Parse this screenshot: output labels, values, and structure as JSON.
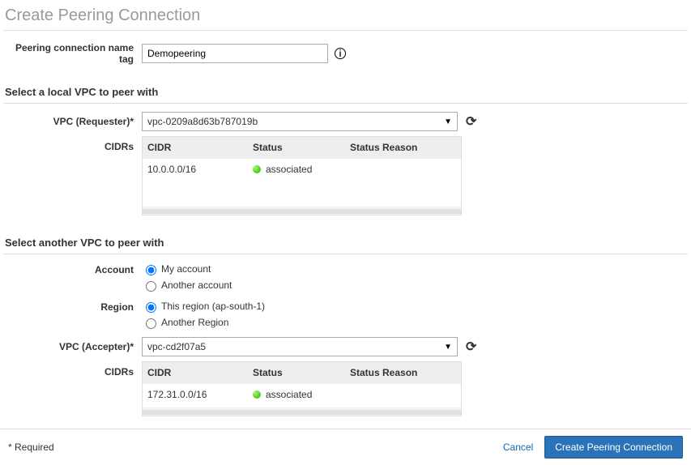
{
  "header": {
    "title": "Create Peering Connection"
  },
  "nameTag": {
    "label": "Peering connection name tag",
    "value": "Demopeering"
  },
  "sectionLocal": {
    "title": "Select a local VPC to peer with",
    "requesterLabel": "VPC (Requester)*",
    "requesterValue": "vpc-0209a8d63b787019b",
    "cidrsLabel": "CIDRs",
    "table": {
      "headers": {
        "cidr": "CIDR",
        "status": "Status",
        "reason": "Status Reason"
      },
      "rows": [
        {
          "cidr": "10.0.0.0/16",
          "status": "associated",
          "reason": ""
        }
      ]
    }
  },
  "sectionOther": {
    "title": "Select another VPC to peer with",
    "accountLabel": "Account",
    "accountOptions": {
      "mine": "My account",
      "another": "Another account"
    },
    "regionLabel": "Region",
    "regionOptions": {
      "this": "This region (ap-south-1)",
      "another": "Another Region"
    },
    "accepterLabel": "VPC (Accepter)*",
    "accepterValue": "vpc-cd2f07a5",
    "cidrsLabel": "CIDRs",
    "table": {
      "headers": {
        "cidr": "CIDR",
        "status": "Status",
        "reason": "Status Reason"
      },
      "rows": [
        {
          "cidr": "172.31.0.0/16",
          "status": "associated",
          "reason": ""
        }
      ]
    }
  },
  "footer": {
    "required": "* Required",
    "cancel": "Cancel",
    "submit": "Create Peering Connection"
  }
}
